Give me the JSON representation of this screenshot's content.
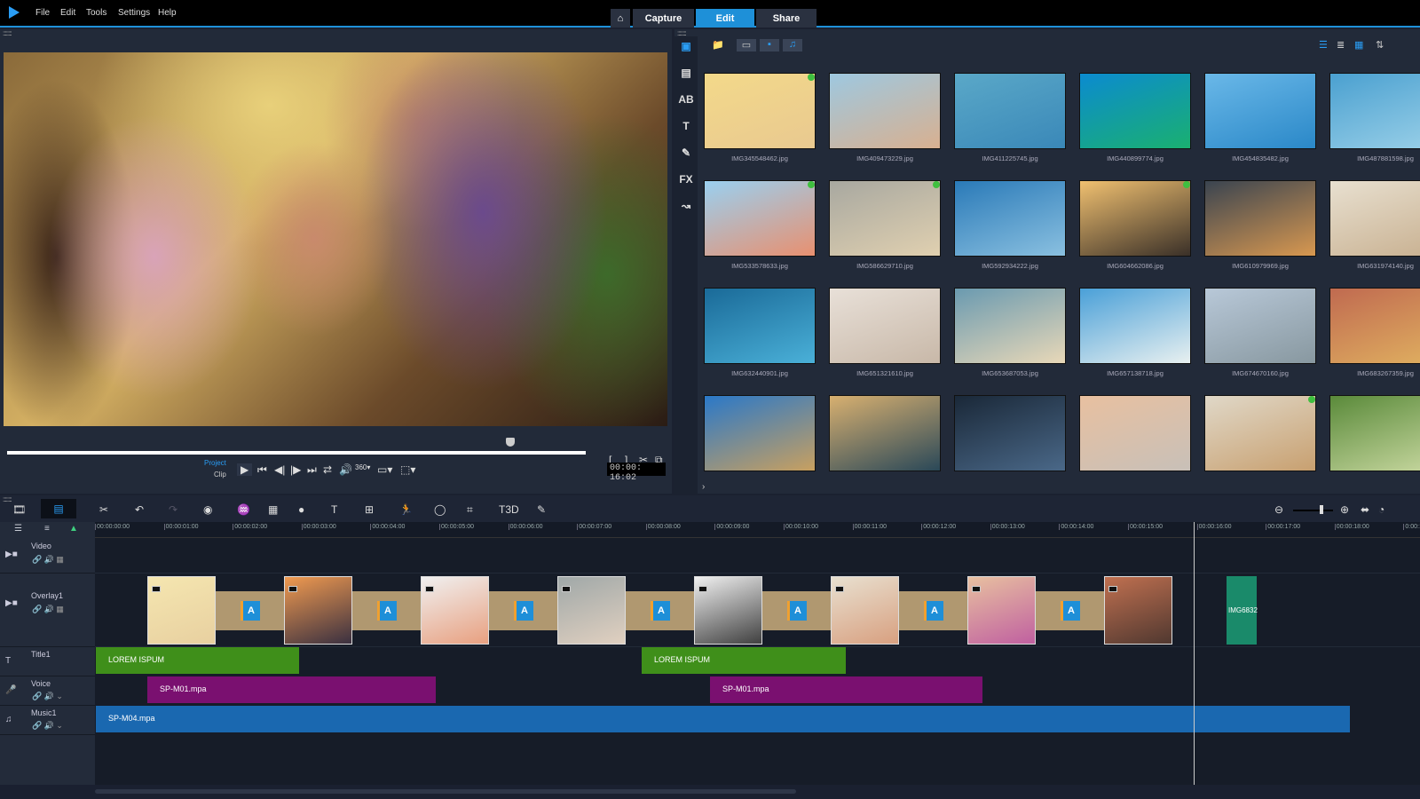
{
  "menu": {
    "items": [
      "File",
      "Edit",
      "Tools",
      "Settings",
      "Help"
    ]
  },
  "modes": {
    "home_icon": "home-icon",
    "capture": "Capture",
    "edit": "Edit",
    "share": "Share",
    "active": "Edit"
  },
  "player": {
    "project_label": "Project",
    "clip_label": "Clip",
    "timecode": "00:00: 16:02",
    "icons": [
      "play",
      "home",
      "prev-frame",
      "next-frame",
      "end",
      "repeat",
      "volume",
      "360",
      "aspect",
      "crop"
    ]
  },
  "library": {
    "items": [
      {
        "name": "IMG345548462.jpg",
        "checked": true,
        "colors": [
          "#f3d98a",
          "#e9c990"
        ]
      },
      {
        "name": "IMG409473229.jpg",
        "checked": false,
        "colors": [
          "#9ec8e0",
          "#d8b090"
        ]
      },
      {
        "name": "IMG411225745.jpg",
        "checked": false,
        "colors": [
          "#5aa8c8",
          "#3a88b8"
        ]
      },
      {
        "name": "IMG440899774.jpg",
        "checked": false,
        "colors": [
          "#0b8bd0",
          "#1ab070"
        ]
      },
      {
        "name": "IMG454835482.jpg",
        "checked": false,
        "colors": [
          "#6ab8e8",
          "#2a88c8"
        ]
      },
      {
        "name": "IMG487881598.jpg",
        "checked": false,
        "colors": [
          "#4aa0d0",
          "#9ad0e8"
        ]
      },
      {
        "name": "IMG533578633.jpg",
        "checked": true,
        "colors": [
          "#9ad0f0",
          "#e89070"
        ]
      },
      {
        "name": "IMG586629710.jpg",
        "checked": true,
        "colors": [
          "#a8a8a0",
          "#e0d0b0"
        ]
      },
      {
        "name": "IMG592934222.jpg",
        "checked": false,
        "colors": [
          "#2a7ab8",
          "#8ac0e0"
        ]
      },
      {
        "name": "IMG604662086.jpg",
        "checked": true,
        "colors": [
          "#f0c070",
          "#3a3028"
        ]
      },
      {
        "name": "IMG610979969.jpg",
        "checked": false,
        "colors": [
          "#3a4450",
          "#d89850"
        ]
      },
      {
        "name": "IMG631974140.jpg",
        "checked": false,
        "colors": [
          "#e8e0d0",
          "#c8b090"
        ]
      },
      {
        "name": "IMG632440901.jpg",
        "checked": false,
        "colors": [
          "#1a6a98",
          "#4ab0d8"
        ]
      },
      {
        "name": "IMG651321610.jpg",
        "checked": false,
        "colors": [
          "#e8e0d8",
          "#c8b8a8"
        ]
      },
      {
        "name": "IMG653687053.jpg",
        "checked": false,
        "colors": [
          "#6a9ab0",
          "#e8d8b8"
        ]
      },
      {
        "name": "IMG657138718.jpg",
        "checked": false,
        "colors": [
          "#4aa0d8",
          "#e8f0f0"
        ]
      },
      {
        "name": "IMG674670160.jpg",
        "checked": false,
        "colors": [
          "#b8c8d8",
          "#8898a0"
        ]
      },
      {
        "name": "IMG683267359.jpg",
        "checked": false,
        "colors": [
          "#c06a50",
          "#e0b060"
        ]
      },
      {
        "name": "",
        "checked": false,
        "colors": [
          "#2a78c8",
          "#c8a060"
        ]
      },
      {
        "name": "",
        "checked": false,
        "colors": [
          "#d8b070",
          "#2a4858"
        ]
      },
      {
        "name": "",
        "checked": false,
        "colors": [
          "#1a2838",
          "#4a6888"
        ]
      },
      {
        "name": "",
        "checked": false,
        "colors": [
          "#e8c0a0",
          "#c8c0b8"
        ]
      },
      {
        "name": "",
        "checked": true,
        "colors": [
          "#e0d8c8",
          "#c8a070"
        ]
      },
      {
        "name": "",
        "checked": false,
        "colors": [
          "#5a8a3a",
          "#c8d8a0"
        ]
      }
    ]
  },
  "timeline": {
    "ruler": [
      "00:00:00:00",
      "00:00:01:00",
      "00:00:02:00",
      "00:00:03:00",
      "00:00:04:00",
      "00:00:05:00",
      "00:00:06:00",
      "00:00:07:00",
      "00:00:08:00",
      "00:00:09:00",
      "00:00:10:00",
      "00:00:11:00",
      "00:00:12:00",
      "00:00:13:00",
      "00:00:14:00",
      "00:00:15:00",
      "00:00:16:00",
      "00:00:17:00",
      "00:00:18:00",
      "0:00:19"
    ],
    "tracks": [
      {
        "name": "Video"
      },
      {
        "name": "Overlay1"
      },
      {
        "name": "Title1"
      },
      {
        "name": "Voice"
      },
      {
        "name": "Music1"
      }
    ],
    "overlay_clips": [
      {
        "colors": [
          "#f5e6b0",
          "#e8d0a0"
        ]
      },
      {
        "colors": [
          "#f09a50",
          "#3a3040"
        ]
      },
      {
        "colors": [
          "#f0f0f0",
          "#e8a080"
        ]
      },
      {
        "colors": [
          "#a0a8a8",
          "#e0d0c0"
        ]
      },
      {
        "colors": [
          "#f0f0f0",
          "#404040"
        ]
      },
      {
        "colors": [
          "#e8e0d0",
          "#d8a080"
        ]
      },
      {
        "colors": [
          "#e8c0a0",
          "#c060a0"
        ]
      },
      {
        "colors": [
          "#c07050",
          "#503830"
        ]
      }
    ],
    "transition_label": "A",
    "last_clip_label": "IMG6832",
    "title_clips": [
      {
        "label": "LOREM ISPUM"
      },
      {
        "label": "LOREM ISPUM"
      }
    ],
    "voice_clips": [
      {
        "label": "SP-M01.mpa"
      },
      {
        "label": "SP-M01.mpa"
      }
    ],
    "music_clips": [
      {
        "label": "SP-M04.mpa"
      }
    ],
    "colors": {
      "title": "#3f8f1a",
      "voice": "#7a1070",
      "music": "#1a68b0",
      "accent": "#1e90d8"
    }
  }
}
